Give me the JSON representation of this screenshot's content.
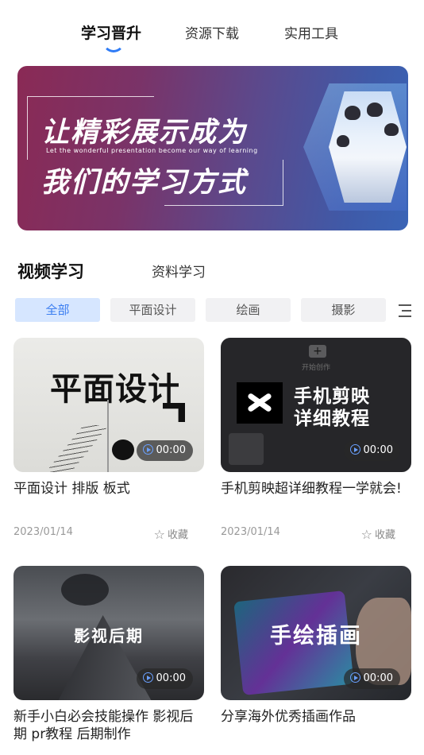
{
  "top_tabs": [
    {
      "label": "学习晋升",
      "active": true
    },
    {
      "label": "资源下载",
      "active": false
    },
    {
      "label": "实用工具",
      "active": false
    }
  ],
  "banner": {
    "title_line1": "让精彩展示成为",
    "subtitle": "Let the wonderful presentation become our way of learning",
    "title_line2": "我们的学习方式"
  },
  "section_tabs": [
    {
      "label": "视频学习",
      "active": true
    },
    {
      "label": "资料学习",
      "active": false
    }
  ],
  "categories": [
    {
      "label": "全部",
      "active": true
    },
    {
      "label": "平面设计",
      "active": false
    },
    {
      "label": "绘画",
      "active": false
    },
    {
      "label": "摄影",
      "active": false
    }
  ],
  "videos": [
    {
      "title": "平面设计 排版 板式",
      "thumb_text": "平面设计",
      "duration": "00:00",
      "date": "2023/01/14",
      "fav_label": "收藏"
    },
    {
      "title": "手机剪映超详细教程一学就会!",
      "thumb_text_line1": "手机剪映",
      "thumb_text_line2": "详细教程",
      "thumb_start": "开始创作",
      "duration": "00:00",
      "date": "2023/01/14",
      "fav_label": "收藏"
    },
    {
      "title": "新手小白必会技能操作 影视后期 pr教程 后期制作",
      "thumb_text": "影视后期",
      "duration": "00:00"
    },
    {
      "title": "分享海外优秀插画作品",
      "thumb_text": "手绘插画",
      "duration": "00:00"
    }
  ],
  "colors": {
    "accent": "#2f7cf6",
    "chip_active_bg": "#d6e6ff",
    "chip_bg": "#f1f1f3"
  }
}
